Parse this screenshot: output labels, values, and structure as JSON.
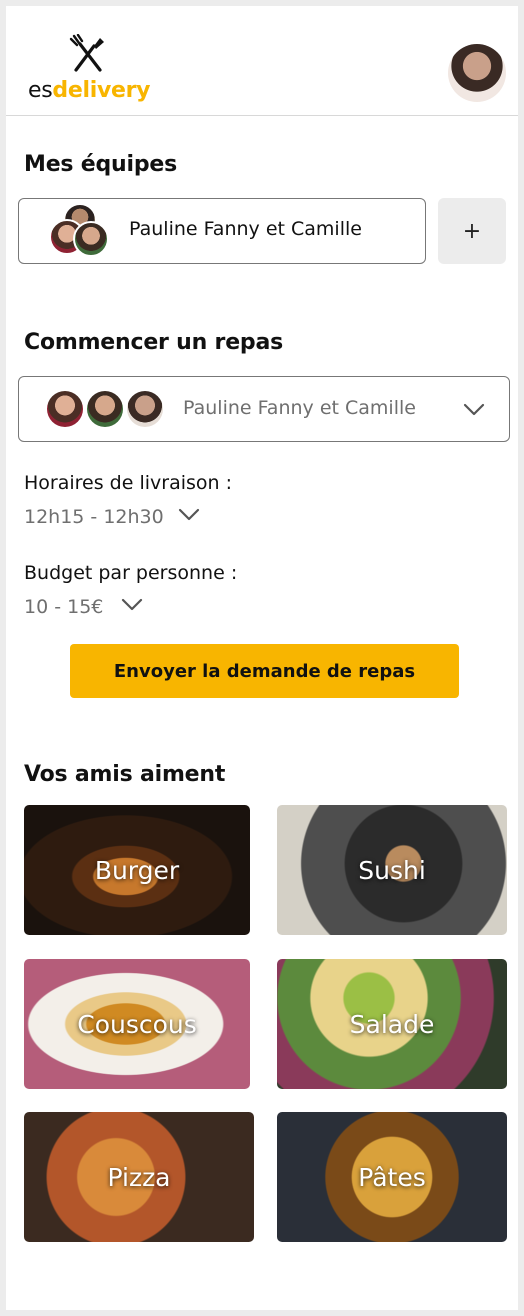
{
  "header": {
    "logo": {
      "prefix": "es",
      "name": "delivery",
      "icon": "fork-knife-icon"
    },
    "profile_avatar": "user-avatar"
  },
  "teams": {
    "title": "Mes équipes",
    "current_team": "Pauline Fanny et Camille",
    "add_label": "+"
  },
  "meal": {
    "title": "Commencer un repas",
    "selected_team": "Pauline Fanny et Camille",
    "delivery_label": "Horaires de livraison :",
    "delivery_value": "12h15 - 12h30",
    "budget_label": "Budget par personne :",
    "budget_value": "10 - 15€",
    "submit_label": "Envoyer la demande de repas"
  },
  "friends": {
    "title": "Vos amis aiment",
    "cuisines": [
      "Burger",
      "Sushi",
      "Couscous",
      "Salade",
      "Pizza",
      "Pâtes"
    ]
  },
  "colors": {
    "accent": "#f8b500",
    "muted_text": "#6f6f6f",
    "border": "#777777"
  }
}
